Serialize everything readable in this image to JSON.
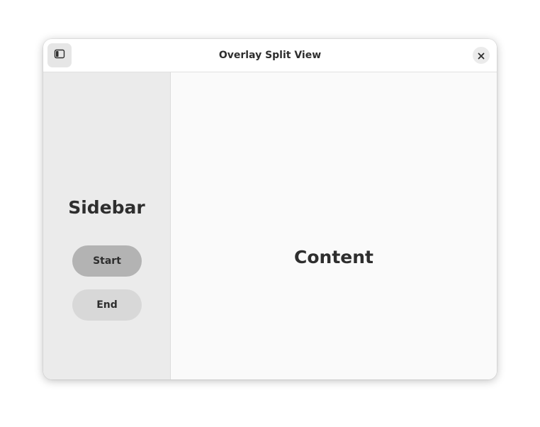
{
  "window": {
    "title": "Overlay Split View"
  },
  "headerbar": {
    "toggle_icon": "sidebar-show-icon",
    "close_icon": "close-icon"
  },
  "sidebar": {
    "title": "Sidebar",
    "buttons": [
      {
        "label": "Start",
        "selected": true
      },
      {
        "label": "End",
        "selected": false
      }
    ]
  },
  "content": {
    "title": "Content"
  },
  "colors": {
    "headerbar_bg": "#ffffff",
    "sidebar_bg": "#ebebeb",
    "content_bg": "#fafafa",
    "selected_pill": "#b3b3b3",
    "unselected_pill": "#d8d8d8",
    "text": "#2e2e2e"
  }
}
